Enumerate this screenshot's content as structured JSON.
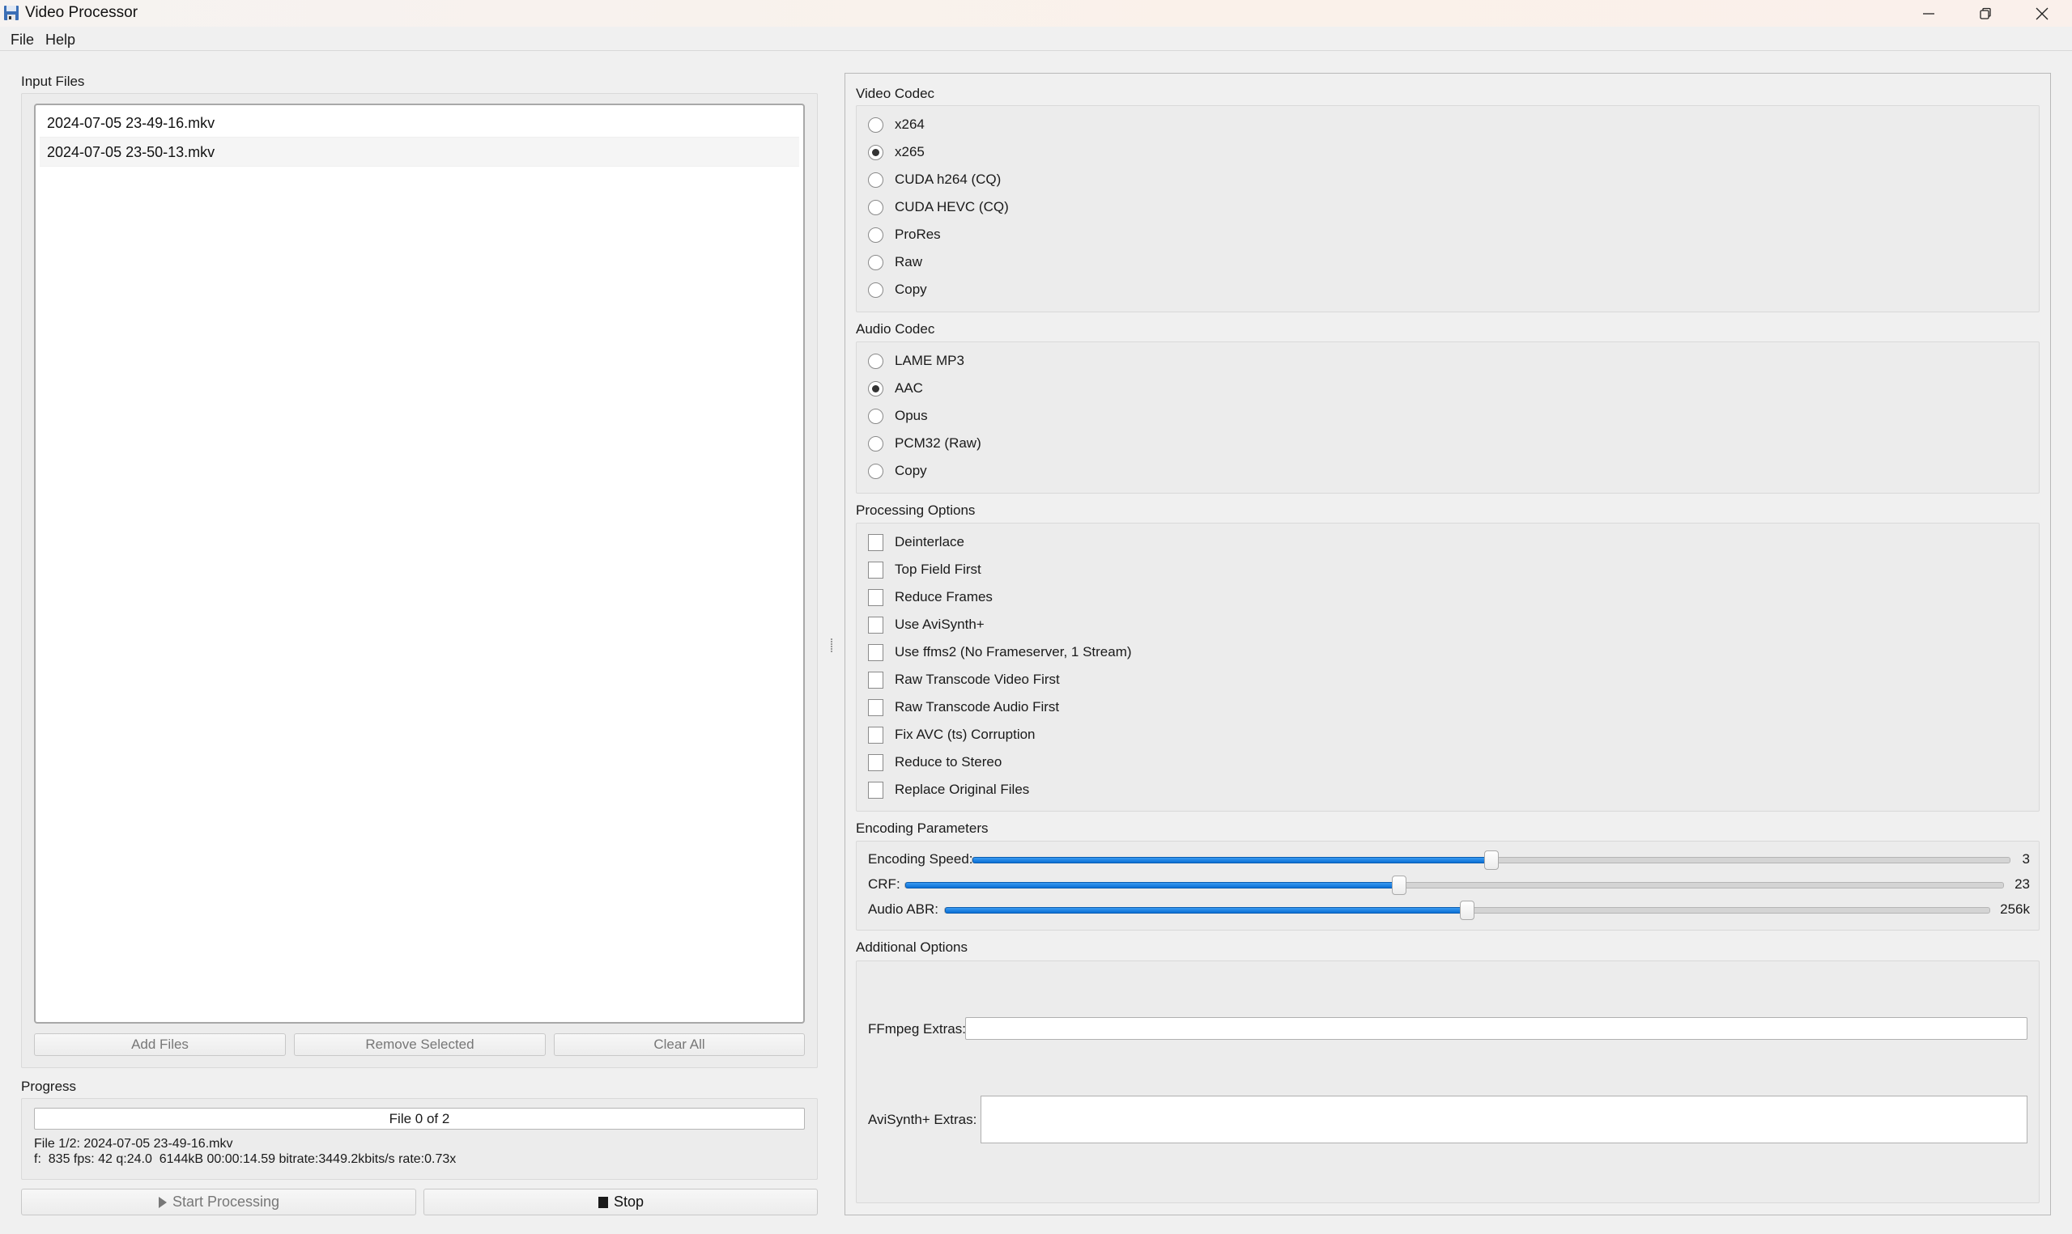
{
  "window": {
    "title": "Video Processor",
    "app_icon": "floppy-disk-icon",
    "controls": {
      "minimize": "minimize-icon",
      "maximize": "restore-icon",
      "close": "close-icon"
    }
  },
  "menu": {
    "items": [
      "File",
      "Help"
    ]
  },
  "input_files": {
    "title": "Input Files",
    "files": [
      "2024-07-05 23-49-16.mkv",
      "2024-07-05 23-50-13.mkv"
    ],
    "buttons": {
      "add": "Add Files",
      "remove": "Remove Selected",
      "clear": "Clear All"
    }
  },
  "progress": {
    "title": "Progress",
    "bar_text": "File 0 of 2",
    "bar_value": 0,
    "status_file": "File 1/2: 2024-07-05 23-49-16.mkv",
    "status_stats": "f:  835 fps: 42 q:24.0  6144kB 00:00:14.59 bitrate:3449.2kbits/s rate:0.73x"
  },
  "actions": {
    "start": {
      "label": "Start Processing",
      "icon": "play-icon",
      "enabled": false
    },
    "stop": {
      "label": "Stop",
      "icon": "stop-icon",
      "enabled": true
    }
  },
  "video_codec": {
    "title": "Video Codec",
    "options": [
      "x264",
      "x265",
      "CUDA h264 (CQ)",
      "CUDA HEVC (CQ)",
      "ProRes",
      "Raw",
      "Copy"
    ],
    "selected": "x265"
  },
  "audio_codec": {
    "title": "Audio Codec",
    "options": [
      "LAME MP3",
      "AAC",
      "Opus",
      "PCM32 (Raw)",
      "Copy"
    ],
    "selected": "AAC"
  },
  "processing_options": {
    "title": "Processing Options",
    "options": [
      {
        "label": "Deinterlace",
        "checked": false
      },
      {
        "label": "Top Field First",
        "checked": false
      },
      {
        "label": "Reduce Frames",
        "checked": false
      },
      {
        "label": "Use AviSynth+",
        "checked": false
      },
      {
        "label": "Use ffms2 (No Frameserver, 1 Stream)",
        "checked": false
      },
      {
        "label": "Raw Transcode Video First",
        "checked": false
      },
      {
        "label": "Raw Transcode Audio First",
        "checked": false
      },
      {
        "label": "Fix AVC (ts) Corruption",
        "checked": false
      },
      {
        "label": "Reduce to Stereo",
        "checked": false
      },
      {
        "label": "Replace Original Files",
        "checked": false
      }
    ]
  },
  "encoding_parameters": {
    "title": "Encoding Parameters",
    "sliders": [
      {
        "label": "Encoding Speed:",
        "value": "3",
        "fraction": 0.5
      },
      {
        "label": "CRF:",
        "value": "23",
        "fraction": 0.45
      },
      {
        "label": "Audio ABR:",
        "value": "256k",
        "fraction": 0.5
      }
    ]
  },
  "additional_options": {
    "title": "Additional Options",
    "ffmpeg_label": "FFmpeg Extras:",
    "ffmpeg_value": "",
    "avisynth_label": "AviSynth+ Extras:",
    "avisynth_value": ""
  },
  "colors": {
    "slider_fill": "#0a78e0",
    "window_bg": "#f0f0f0",
    "titlebar_bg": "#faf1ea"
  }
}
